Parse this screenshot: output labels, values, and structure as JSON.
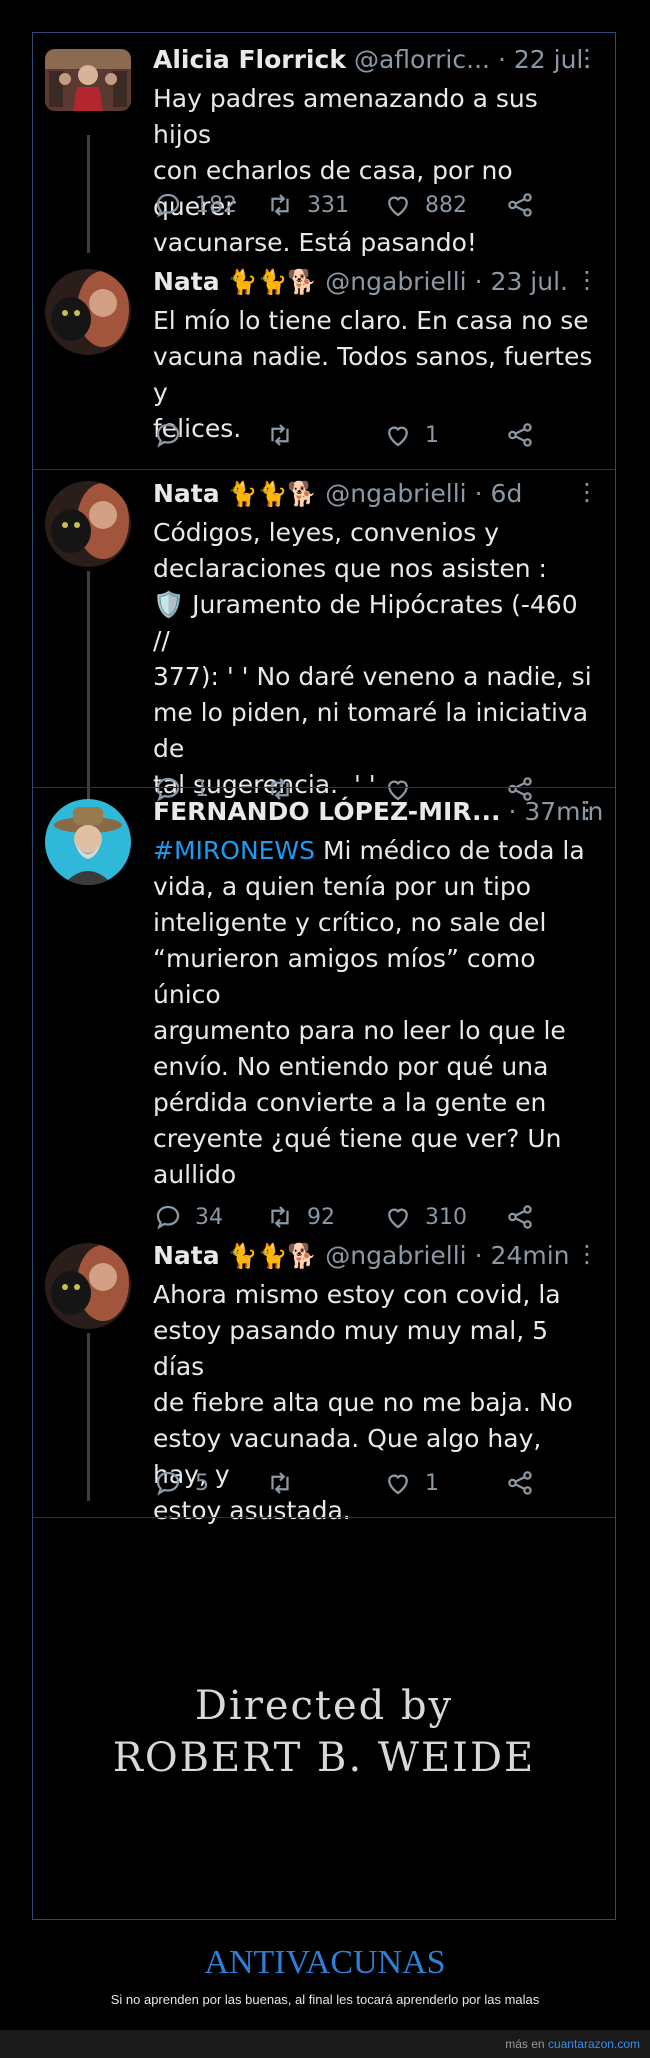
{
  "tweets": [
    {
      "name": "Alicia Florrick",
      "handle": "@aflorric...",
      "time": "· 22 jul.",
      "text": "Hay padres amenazando a sus hijos\ncon echarlos de casa, por no querer\nvacunarse. Está pasando!",
      "replies": "182",
      "retweets": "331",
      "likes": "882"
    },
    {
      "name": "Nata",
      "emoji": "🐈🐈🐕",
      "handle": "@ngabrielli",
      "time": "· 23 jul.",
      "text": "El mío lo tiene claro. En casa no se\nvacuna nadie. Todos sanos, fuertes y\nfelices.",
      "replies": "",
      "retweets": "",
      "likes": "1"
    },
    {
      "name": "Nata",
      "emoji": "🐈🐈🐕",
      "handle": "@ngabrielli",
      "time": "· 6d",
      "text": "Códigos, leyes, convenios y\ndeclaraciones que nos asisten :\n🛡️ Juramento de Hipócrates (-460 //\n377): ' ' No daré veneno a nadie, si\nme lo piden, ni tomaré la iniciativa de\ntal sugerencia.  ' '",
      "replies": "1",
      "retweets": "",
      "likes": ""
    },
    {
      "name": "FERNANDO LÓPEZ-MIR...",
      "handle": "",
      "time": "· 37min",
      "hashtag": "#MIRONEWS",
      "text": " Mi médico de toda la\nvida, a quien tenía por un tipo\ninteligente y crítico, no sale del\n“murieron amigos míos” como único\nargumento para no leer lo que le\nenvío. No entiendo por qué una\npérdida convierte a la gente en\ncreyente ¿qué tiene que ver? Un\naullido",
      "replies": "34",
      "retweets": "92",
      "likes": "310"
    },
    {
      "name": "Nata",
      "emoji": "🐈🐈🐕",
      "handle": "@ngabrielli",
      "time": "· 24min",
      "text": "Ahora mismo estoy con covid, la\nestoy pasando muy muy mal, 5 días\nde fiebre alta que no me baja. No\nestoy vacunada. Que algo hay, hay, y\nestoy asustada.",
      "replies": "5",
      "retweets": "",
      "likes": "1"
    }
  ],
  "directed": {
    "line1": "Directed by",
    "line2": "ROBERT B. WEIDE"
  },
  "footer": {
    "title": "ANTIVACUNAS",
    "subtitle": "Si no aprenden por las buenas, al final les tocará aprenderlo por las malas",
    "credit_prefix": "más en",
    "credit_link": "cuantarazon.com"
  },
  "colors": {
    "accent": "#1d9bf0",
    "text": "#e7e9ea",
    "muted": "#8b98a5",
    "title": "#2f7fd6"
  }
}
